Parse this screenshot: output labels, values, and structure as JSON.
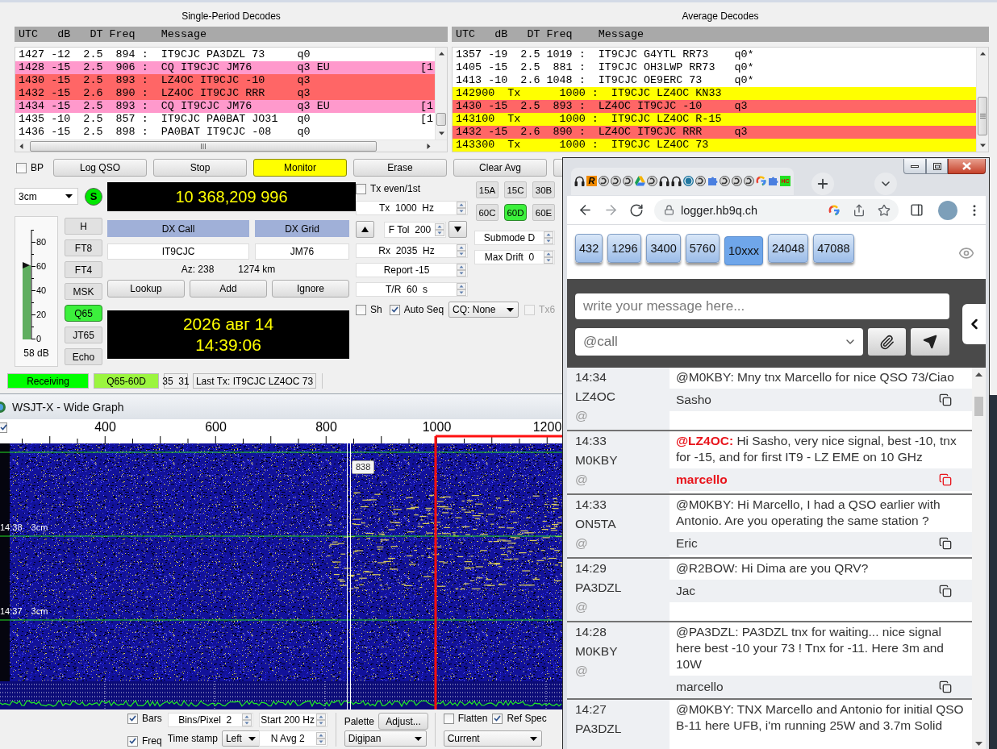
{
  "main_window": {
    "decode_panels": [
      {
        "title": "Single-Period Decodes",
        "header": "UTC   dB   DT Freq    Message",
        "horizontal_scrollbar": true,
        "rows": [
          {
            "kind": "plain",
            "text": "1427 -12  2.5  894 :  IT9CJC PA3DZL 73     q0"
          },
          {
            "kind": "cq",
            "text": "1428 -15  2.5  906 :  CQ IT9CJC JM76       q3 EU",
            "tail": "[1"
          },
          {
            "kind": "to_me",
            "text": "1430 -15  2.5  893 :  LZ4OC IT9CJC -10     q3"
          },
          {
            "kind": "to_me",
            "text": "1432 -15  2.6  890 :  LZ4OC IT9CJC RRR     q3"
          },
          {
            "kind": "cq",
            "text": "1434 -15  2.5  893 :  CQ IT9CJC JM76       q3 EU",
            "tail": "[1"
          },
          {
            "kind": "plain",
            "text": "1435 -10  2.5  857 :  IT9CJC PA0BAT JO31   q0",
            "tail": "[1"
          },
          {
            "kind": "plain",
            "text": "1436 -15  2.5  898 :  PA0BAT IT9CJC -08    q0"
          }
        ]
      },
      {
        "title": "Average Decodes",
        "header": "UTC   dB   DT Freq    Message",
        "rows": [
          {
            "kind": "plain",
            "text": "1357 -19  2.5 1019 :  IT9CJC G4YTL RR73    q0*"
          },
          {
            "kind": "plain",
            "text": "1405 -15  2.5  881 :  IT9CJC OH3LWP RR73   q0*"
          },
          {
            "kind": "plain",
            "text": "1413 -10  2.6 1048 :  IT9CJC OE9ERC 73     q0*"
          },
          {
            "kind": "tx",
            "text": "142900  Tx      1000 :  IT9CJC LZ4OC KN33"
          },
          {
            "kind": "to_me",
            "text": "1430 -15  2.5  893 :  LZ4OC IT9CJC -10     q3"
          },
          {
            "kind": "tx",
            "text": "143100  Tx      1000 :  IT9CJC LZ4OC R-15"
          },
          {
            "kind": "to_me",
            "text": "1432 -15  2.6  890 :  LZ4OC IT9CJC RRR     q3"
          },
          {
            "kind": "tx",
            "text": "143300  Tx      1000 :  IT9CJC LZ4OC 73"
          }
        ]
      }
    ],
    "bp": {
      "label": "BP",
      "checked": false
    },
    "action_buttons": [
      {
        "label": "Log QSO",
        "active": false
      },
      {
        "label": "Stop",
        "active": false
      },
      {
        "label": "Monitor",
        "active": true
      },
      {
        "label": "Erase",
        "active": false
      },
      {
        "label": "Clear Avg",
        "active": false
      }
    ],
    "band": "3cm",
    "sync_indicator": {
      "label": "S",
      "on": true
    },
    "meter": {
      "scale": [
        "80",
        "60",
        "40",
        "20",
        "0"
      ],
      "level": 0.68,
      "reading": "58 dB"
    },
    "modes": [
      {
        "label": "H",
        "selected": false
      },
      {
        "label": "FT8",
        "selected": false
      },
      {
        "label": "FT4",
        "selected": false
      },
      {
        "label": "MSK",
        "selected": false
      },
      {
        "label": "Q65",
        "selected": true
      },
      {
        "label": "JT65",
        "selected": false
      },
      {
        "label": "Echo",
        "selected": false
      }
    ],
    "frequency": "10 368,209 996",
    "dx": {
      "call_label": "DX Call",
      "grid_label": "DX Grid",
      "call": "IT9CJC",
      "grid": "JM76",
      "azimuth": "Az: 238",
      "distance": "1274 km"
    },
    "dx_buttons": [
      "Lookup",
      "Add",
      "Ignore"
    ],
    "clock": {
      "date": "2026 авг 14",
      "time": "14:39:06"
    },
    "tx_even": {
      "label": "Tx even/1st",
      "checked": false
    },
    "tx_freq": "Tx  1000  Hz",
    "f_tol": "F Tol  200",
    "rx_freq": "Rx  2035  Hz",
    "report": "Report -15",
    "tr_period": "T/R  60  s",
    "sh": {
      "label": "Sh",
      "checked": false
    },
    "auto_seq": {
      "label": "Auto Seq",
      "checked": true
    },
    "cq": "CQ: None",
    "tx6": {
      "label": "Tx6",
      "checked": false,
      "disabled": true
    },
    "submodes": [
      {
        "label": "15A",
        "selected": false
      },
      {
        "label": "15C",
        "selected": false
      },
      {
        "label": "30B",
        "selected": false
      },
      {
        "label": "60C",
        "selected": false
      },
      {
        "label": "60D",
        "selected": true
      },
      {
        "label": "60E",
        "selected": false
      }
    ],
    "submode": "Submode D",
    "max_drift": "Max Drift  0",
    "status": {
      "state": "Receiving",
      "mode": "Q65-60D",
      "counts": "35  31",
      "last_tx": "Last Tx: IT9CJC LZ4OC 73"
    }
  },
  "wide_graph": {
    "title": "WSJT-X - Wide Graph",
    "ruler_checkbox": {
      "checked": true
    },
    "ruler_labels": [
      "400",
      "600",
      "800",
      "1000",
      "1200"
    ],
    "time_marks": [
      {
        "time": "14:38",
        "band": "3cm"
      },
      {
        "time": "14:37",
        "band": "3cm"
      }
    ],
    "cursor_label": "838",
    "bars": {
      "label": "Bars",
      "checked": true
    },
    "freq": {
      "label": "Freq",
      "checked": true
    },
    "bins_per_pixel": "Bins/Pixel  2",
    "time_stamp_label": "Time stamp",
    "time_stamp": "Left",
    "start": "Start 200 Hz",
    "n_avg": "N Avg 2",
    "palette_label": "Palette",
    "adjust_button": "Adjust...",
    "palette": "Digipan",
    "flatten": {
      "label": "Flatten",
      "checked": false
    },
    "ref_spec": {
      "label": "Ref Spec",
      "checked": true
    },
    "spectrum": "Current"
  },
  "browser": {
    "tabs": [
      {
        "kind": "headset"
      },
      {
        "kind": "letter",
        "text": "R"
      },
      {
        "kind": "swirl"
      },
      {
        "kind": "swirl"
      },
      {
        "kind": "swirl"
      },
      {
        "kind": "drive"
      },
      {
        "kind": "swirl"
      },
      {
        "kind": "headset"
      },
      {
        "kind": "headset"
      },
      {
        "kind": "circle_logo"
      },
      {
        "kind": "swirl"
      },
      {
        "kind": "puzzle"
      },
      {
        "kind": "swirl"
      },
      {
        "kind": "swirl"
      },
      {
        "kind": "swirl"
      },
      {
        "kind": "google"
      },
      {
        "kind": "puzzle"
      },
      {
        "kind": "tile",
        "text": "HC"
      }
    ],
    "url": "logger.hb9q.ch",
    "bands": [
      {
        "label": "432",
        "selected": false
      },
      {
        "label": "1296",
        "selected": false
      },
      {
        "label": "3400",
        "selected": false
      },
      {
        "label": "5760",
        "selected": false
      },
      {
        "label": "10xxx",
        "selected": true
      },
      {
        "label": "24048",
        "selected": false
      },
      {
        "label": "47088",
        "selected": false
      }
    ],
    "message_placeholder": "write your message here...",
    "call_placeholder": "@call",
    "messages": [
      {
        "time": "14:34",
        "call": "LZ4OC",
        "at": "@",
        "text": "@M0KBY: Mny tnx Marcello for nice QSO 73/Ciao",
        "author": "Sasho",
        "highlighted": false
      },
      {
        "time": "14:33",
        "call": "M0KBY",
        "at": "@",
        "text": "**@LZ4OC:** Hi Sasho, very nice signal, best -10, tnx for -15, and for first IT9 - LZ EME on 10 GHz",
        "author": "marcello",
        "highlighted": true
      },
      {
        "time": "14:33",
        "call": "ON5TA",
        "at": "@",
        "text": "@M0KBY: Hi Marcello, I had a QSO earlier with Antonio. Are you operating the same station ?",
        "author": "Eric",
        "highlighted": false
      },
      {
        "time": "14:29",
        "call": "PA3DZL",
        "at": "@",
        "text": "@R2BOW: Hi Dima are you QRV?",
        "author": "Jac",
        "highlighted": false
      },
      {
        "time": "14:28",
        "call": "M0KBY",
        "at": "@",
        "text": "@PA3DZL: PA3DZL tnx for waiting... nice signal here best -10 your 73 ! Tnx for -11. Here 3m and 10W",
        "author": "marcello",
        "highlighted": false
      },
      {
        "time": "14:27",
        "call": "PA3DZL",
        "text": "@M0KBY: TNX Marcello and Antonio for initial QSO B-11 here UFB, i'm running 25W and 3.7m Solid"
      }
    ]
  }
}
